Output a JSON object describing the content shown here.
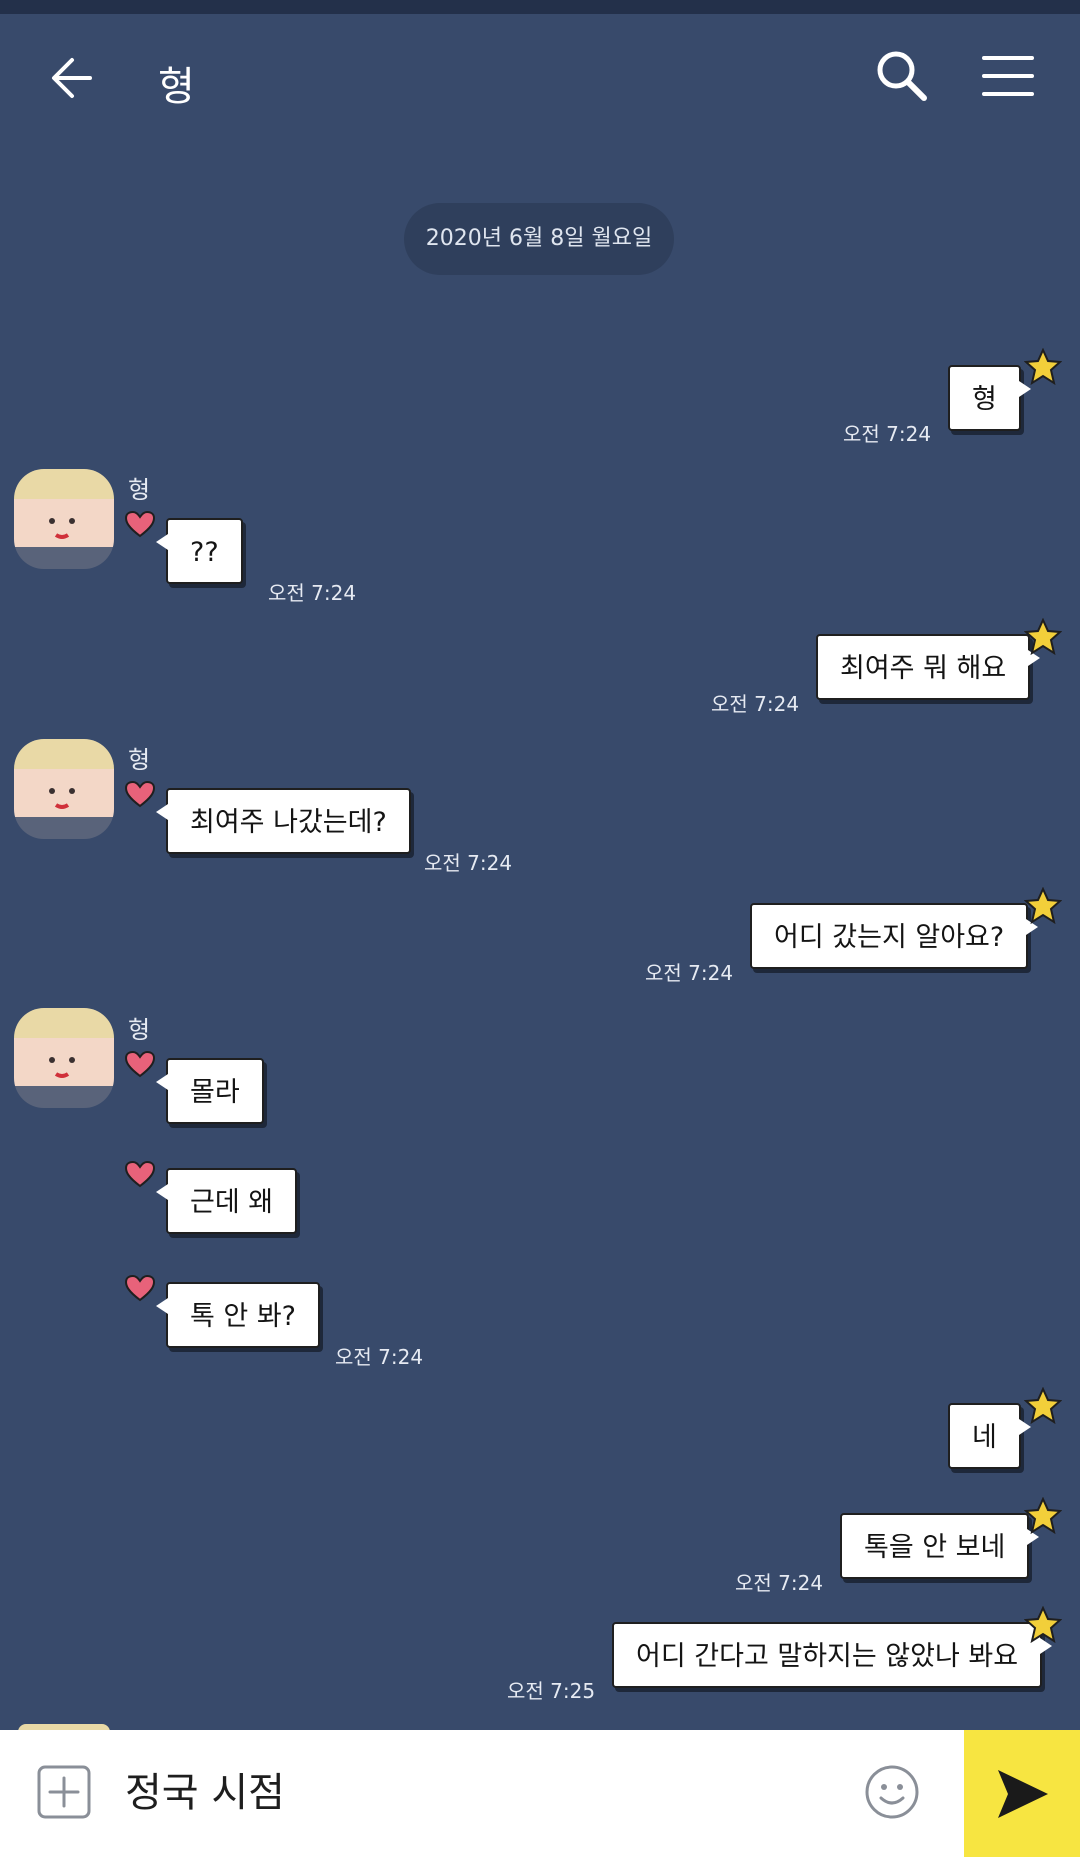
{
  "header": {
    "title": "형"
  },
  "date_divider": "2020년 6월 8일 월요일",
  "messages": [
    {
      "side": "me",
      "text": "형",
      "time": "오전 7:24"
    },
    {
      "side": "them",
      "sender": "형",
      "text": "??",
      "time": "오전 7:24"
    },
    {
      "side": "me",
      "text": "최여주 뭐 해요",
      "time": "오전 7:24"
    },
    {
      "side": "them",
      "sender": "형",
      "text": "최여주 나갔는데?",
      "time": "오전 7:24"
    },
    {
      "side": "me",
      "text": "어디 갔는지 알아요?",
      "time": "오전 7:24"
    },
    {
      "side": "them",
      "sender": "형",
      "text": "몰라"
    },
    {
      "side": "them",
      "text": "근데 왜"
    },
    {
      "side": "them",
      "text": "톡 안 봐?",
      "time": "오전 7:24"
    },
    {
      "side": "me",
      "text": "네"
    },
    {
      "side": "me",
      "text": "톡을 안 보네",
      "time": "오전 7:24"
    },
    {
      "side": "me",
      "text": "어디 간다고 말하지는 않았나 봐요",
      "time": "오전 7:25"
    }
  ],
  "input": {
    "value": "정국 시점"
  },
  "colors": {
    "background": "#384a6b",
    "send_button": "#f7e541",
    "star": "#f2cf3a",
    "heart": "#e8627a"
  }
}
